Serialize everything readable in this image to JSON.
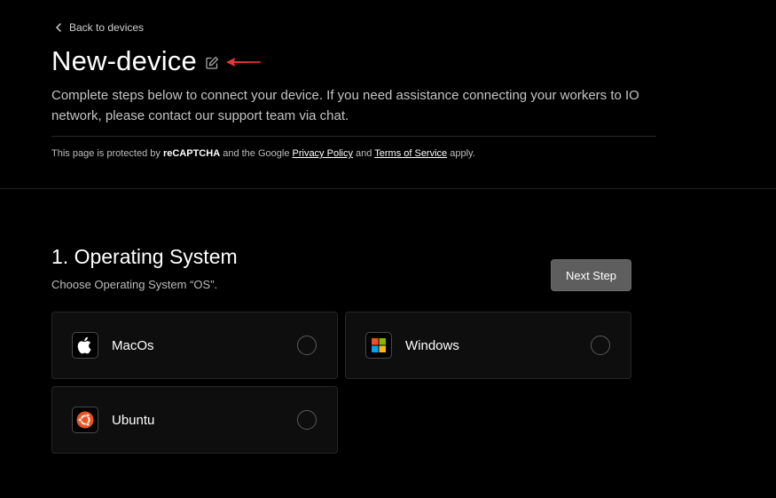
{
  "nav": {
    "back_label": "Back to devices"
  },
  "header": {
    "title": "New-device",
    "description": "Complete steps below to connect your device. If you need assistance connecting your workers to IO network, please contact our support team via chat."
  },
  "recaptcha": {
    "prefix": "This page is protected by ",
    "brand": "reCAPTCHA",
    "middle": " and the Google ",
    "privacy_link": "Privacy Policy",
    "and": " and ",
    "terms_link": "Terms of Service",
    "suffix": " apply."
  },
  "step": {
    "title": "1. Operating System",
    "subtitle": "Choose Operating System “OS”.",
    "next_label": "Next Step"
  },
  "os_options": [
    {
      "label": "MacOs",
      "icon": "apple-icon"
    },
    {
      "label": "Windows",
      "icon": "windows-icon"
    },
    {
      "label": "Ubuntu",
      "icon": "ubuntu-icon"
    }
  ],
  "colors": {
    "background": "#000000",
    "card_background": "#0e0e0e",
    "annotation_arrow": "#e8353d",
    "ubuntu_orange": "#e95420",
    "windows_red": "#f25022",
    "windows_green": "#7fba00",
    "windows_blue": "#00a4ef",
    "windows_yellow": "#ffb900",
    "button_background": "#5e5e5e"
  }
}
